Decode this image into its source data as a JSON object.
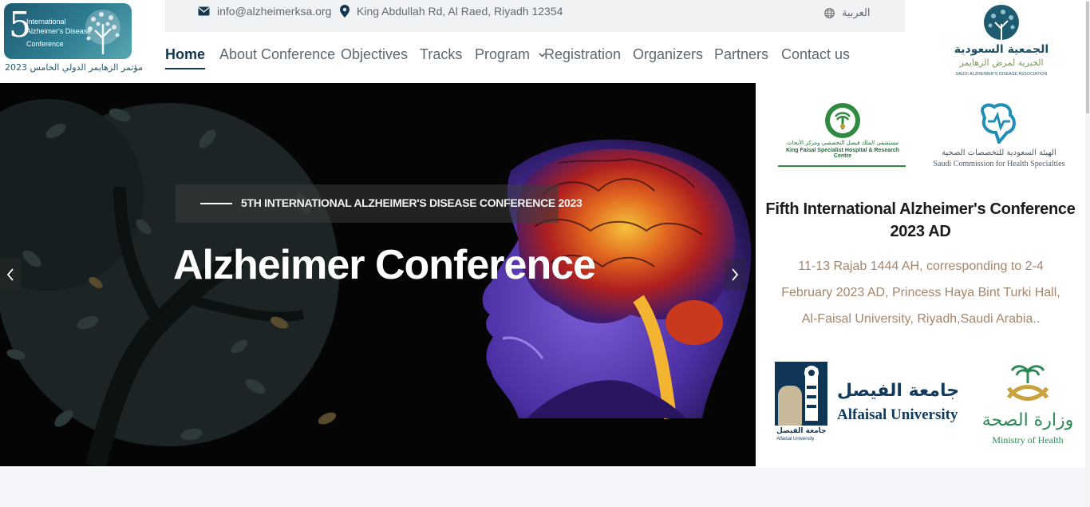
{
  "logo": {
    "number": "5",
    "line1": "International",
    "line2": "Alzheimer's Disease",
    "line3": "Conference",
    "arabic": "مؤتمر الزهايمر الدولي الخامس 2023"
  },
  "topbar": {
    "email": "info@alzheimerksa.org",
    "address": "King Abdullah Rd, Al Raed, Riyadh 12354",
    "language": "العربية"
  },
  "nav": {
    "items": [
      "Home",
      "About Conference",
      "Objectives",
      "Tracks",
      "Program",
      "Registration",
      "Organizers",
      "Partners",
      "Contact us"
    ]
  },
  "association_logo": {
    "arabic_line1": "الجمعية السعودية",
    "arabic_line2": "الخيرية لمرض الزهايمر",
    "english": "SAUDI ALZHEIMER'S DISEASE ASSOCIATION"
  },
  "hero": {
    "subtitle": "5TH INTERNATIONAL ALZHEIMER'S DISEASE CONFERENCE 2023",
    "title": "Alzheimer Conference"
  },
  "partners": {
    "kfsh_arabic": "مستشفى الملك فيصل التخصصي ومركز الأبحاث",
    "kfsh_english": "King Faisal Specialist Hospital & Research Centre",
    "scfhs_arabic": "الهيئة السعودية للتخصصات الصحية",
    "scfhs_english": "Saudi Commission for Health Specialties",
    "alfaisal_arabic": "جامعة الفيصل",
    "alfaisal_english": "Alfaisal University",
    "alfaisal_small_arabic": "جامعة الفيصل",
    "alfaisal_small_english": "Alfaisal University",
    "moh_arabic": "وزارة الصحة",
    "moh_english": "Ministry of Health"
  },
  "side": {
    "title": "Fifth International Alzheimer's Conference 2023 AD",
    "description": "11-13 Rajab 1444 AH, corresponding to 2-4 February 2023 AD, Princess Haya Bint Turki Hall, Al-Faisal University, Riyadh,Saudi Arabia.."
  },
  "colors": {
    "nav_active": "#12374f",
    "nav_text": "#5e6870",
    "desc_text": "#a6866b",
    "topbar_bg": "#f1f2f4"
  }
}
